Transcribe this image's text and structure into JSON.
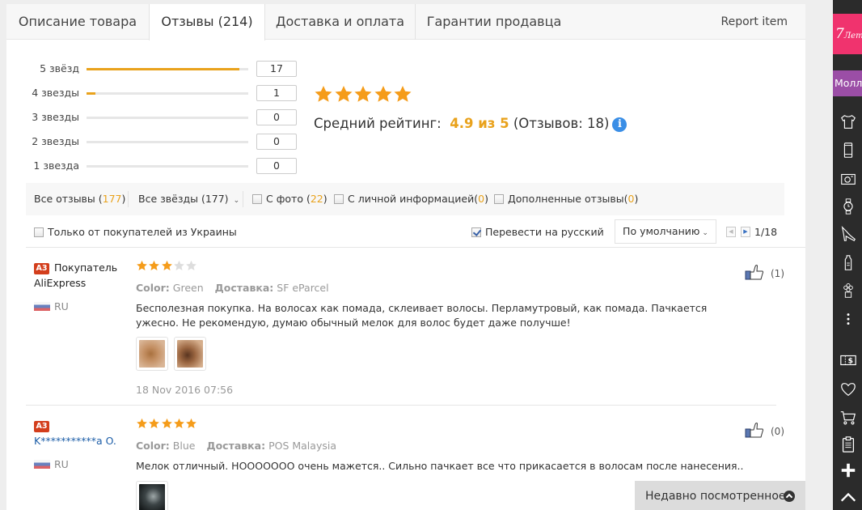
{
  "tabs": [
    {
      "label": "Описание товара",
      "active": false
    },
    {
      "label": "Отзывы (214)",
      "active": true
    },
    {
      "label": "Доставка и оплата",
      "active": false
    },
    {
      "label": "Гарантии продавца",
      "active": false
    }
  ],
  "report_label": "Report item",
  "rating_breakdown": [
    {
      "label": "5 звёзд",
      "count": "17",
      "fraction": 0.944
    },
    {
      "label": "4 звезды",
      "count": "1",
      "fraction": 0.056
    },
    {
      "label": "3 звезды",
      "count": "0",
      "fraction": 0
    },
    {
      "label": "2 звезды",
      "count": "0",
      "fraction": 0
    },
    {
      "label": "1 звезда",
      "count": "0",
      "fraction": 0
    }
  ],
  "summary": {
    "stars_filled": 5,
    "avg_prefix": "Средний рейтинг:",
    "avg_value": "4.9 из 5",
    "avg_suffix": "(Отзывов: 18)",
    "info_icon": "i"
  },
  "filters": {
    "all_reviews_label": "Все отзывы (",
    "all_reviews_count": "177",
    "all_reviews_close": ")",
    "all_stars_label": "Все звёзды (177)",
    "chevron": "⌄",
    "with_photo_label": "С фото (",
    "with_photo_count": "22",
    "with_photo_close": ")",
    "personal_label": "С личной информацией(",
    "personal_count": "0",
    "personal_close": ")",
    "additional_label": "Дополненные отзывы(",
    "additional_count": "0",
    "additional_close": ")"
  },
  "options": {
    "ukraine_only_label": "Только от покупателей из Украины",
    "ukraine_only_checked": false,
    "translate_label": "Перевести на русский",
    "translate_checked": true,
    "sort_value": "По умолчанию",
    "sort_chevron": "⌄",
    "prev_icon": "◀",
    "next_icon": "▶",
    "page_text": "1/18"
  },
  "reviews": [
    {
      "badge": "A3",
      "user_line1": "Покупатель",
      "user_line2": "AliExpress",
      "country": "RU",
      "rating": 3,
      "color_label": "Color:",
      "color_value": "Green",
      "shipping_label": "Доставка:",
      "shipping_value": "SF eParcel",
      "text": "Бесполезная покупка. На волосах как помада, склеивает волосы. Перламутровый, как помада. Пачкается ужесно. Не рекомендую, думаю обычный мелок для волос будет даже получше!",
      "photos": 2,
      "date": "18 Nov 2016 07:56",
      "likes": "(1)"
    },
    {
      "badge": "A3",
      "user_line1": "K***********a O.",
      "country": "RU",
      "rating": 5,
      "color_label": "Color:",
      "color_value": "Blue",
      "shipping_label": "Доставка:",
      "shipping_value": "POS Malaysia",
      "text": "Мелок отличный. НООООООО очень мажется.. Сильно пачкает все что прикасается в волосам после нанесения..",
      "photos": 1,
      "likes": "(0)"
    }
  ],
  "recently_viewed_label": "Недавно посмотренное",
  "sidebar": {
    "anniversary_label": "7",
    "anniversary_suffix": "Лет",
    "mall_label": "Молл",
    "icons": [
      "tshirt-icon",
      "phone-icon",
      "camera-icon",
      "watch-icon",
      "shoe-icon",
      "baby-bottle-icon",
      "flower-pot-icon",
      "more-icon",
      "coupon-icon",
      "heart-icon",
      "cart-icon",
      "clipboard-icon",
      "plus-icon",
      "chevron-up-icon"
    ]
  },
  "colors": {
    "accent": "#e9a21c",
    "star": "#f59c1a",
    "star_empty": "#dddddd",
    "link": "#1d5ea8",
    "badge": "#d33e1c",
    "info": "#3a8ee6",
    "anniversary": "#f0336e",
    "mall": "#9b4ea6",
    "sidebar": "#2b2b2b"
  }
}
